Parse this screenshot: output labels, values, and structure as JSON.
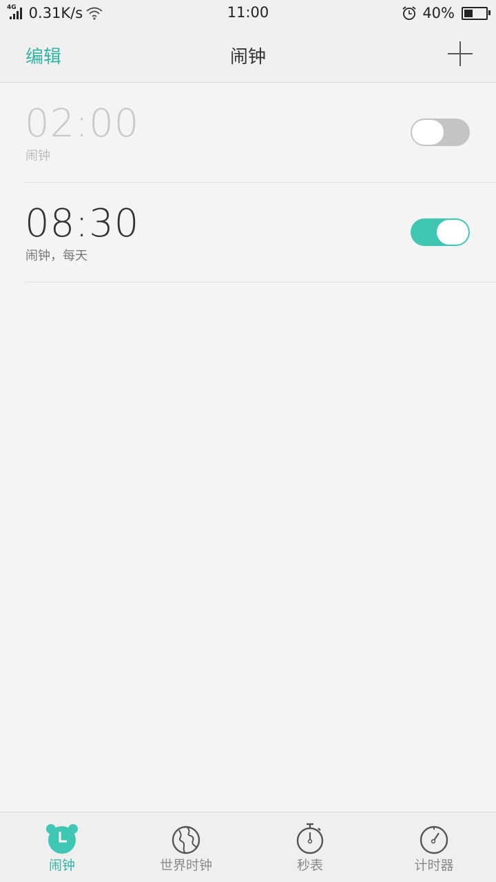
{
  "status_bar": {
    "network": "4G",
    "speed": "0.31K/s",
    "time": "11:00",
    "battery": "40%",
    "battery_level": 0.4
  },
  "header": {
    "edit_label": "编辑",
    "title": "闹钟"
  },
  "alarms": [
    {
      "time": "02:00",
      "label": "闹钟",
      "enabled": false
    },
    {
      "time": "08:30",
      "label": "闹钟，每天",
      "enabled": true
    }
  ],
  "nav": {
    "items": [
      {
        "label": "闹钟",
        "icon": "alarm-clock-icon",
        "active": true
      },
      {
        "label": "世界时钟",
        "icon": "globe-icon",
        "active": false
      },
      {
        "label": "秒表",
        "icon": "stopwatch-icon",
        "active": false
      },
      {
        "label": "计时器",
        "icon": "timer-icon",
        "active": false
      }
    ]
  },
  "colors": {
    "accent": "#33b5a5",
    "toggle_on": "#3fc7b4",
    "toggle_off": "#c4c4c4"
  }
}
